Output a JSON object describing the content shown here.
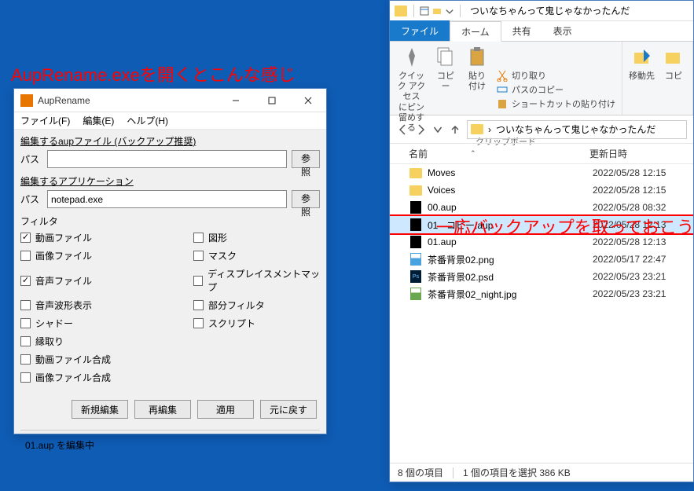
{
  "annotations": {
    "open_hint": "AupRename.exeを開くとこんな感じ",
    "backup_hint": "一応バックアップを取っておこう"
  },
  "auprename": {
    "title": "AupRename",
    "menus": {
      "file": "ファイル(F)",
      "edit": "編集(E)",
      "help": "ヘルプ(H)"
    },
    "groups": {
      "aup_label": "編集するaupファイル (バックアップ推奨)",
      "app_label": "編集するアプリケーション",
      "path_label": "パス",
      "browse": "参照",
      "app_value": "notepad.exe",
      "filter_label": "フィルタ"
    },
    "filters": {
      "video": "動画ファイル",
      "shape": "図形",
      "image": "画像ファイル",
      "mask": "マスク",
      "audio": "音声ファイル",
      "disp": "ディスプレイスメントマップ",
      "wave": "音声波形表示",
      "partial": "部分フィルタ",
      "shadow": "シャドー",
      "script": "スクリプト",
      "border": "縁取り",
      "video_comp": "動画ファイル合成",
      "image_comp": "画像ファイル合成"
    },
    "buttons": {
      "new_edit": "新規編集",
      "reedit": "再編集",
      "apply": "適用",
      "revert": "元に戻す"
    },
    "status": "01.aup を編集中"
  },
  "explorer": {
    "window_title": "ついなちゃんって鬼じゃなかったんだ",
    "tabs": {
      "file": "ファイル",
      "home": "ホーム",
      "share": "共有",
      "view": "表示"
    },
    "ribbon": {
      "quick_access_pin": "クイック アクセス\nにピン留めする",
      "copy": "コピー",
      "paste": "貼り付け",
      "cut": "切り取り",
      "copy_path": "パスのコピー",
      "paste_shortcut": "ショートカットの貼り付け",
      "clipboard_group": "クリップボード",
      "move_to": "移動先",
      "copy_to": "コピ"
    },
    "address": "ついなちゃんって鬼じゃなかったんだ",
    "headers": {
      "name": "名前",
      "date": "更新日時"
    },
    "files": [
      {
        "name": "Moves",
        "date": "2022/05/28 12:15",
        "type": "folder"
      },
      {
        "name": "Voices",
        "date": "2022/05/28 12:15",
        "type": "folder"
      },
      {
        "name": "00.aup",
        "date": "2022/05/28 08:32",
        "type": "aup"
      },
      {
        "name": "01 - コピー.aup",
        "date": "2022/05/28 12:13",
        "type": "aup",
        "selected": true
      },
      {
        "name": "01.aup",
        "date": "2022/05/28 12:13",
        "type": "aup"
      },
      {
        "name": "茶番背景02.png",
        "date": "2022/05/17 22:47",
        "type": "png"
      },
      {
        "name": "茶番背景02.psd",
        "date": "2022/05/23 23:21",
        "type": "psd"
      },
      {
        "name": "茶番背景02_night.jpg",
        "date": "2022/05/23 23:21",
        "type": "jpg"
      }
    ],
    "status": {
      "count": "8 個の項目",
      "selection": "1 個の項目を選択 386 KB"
    }
  }
}
